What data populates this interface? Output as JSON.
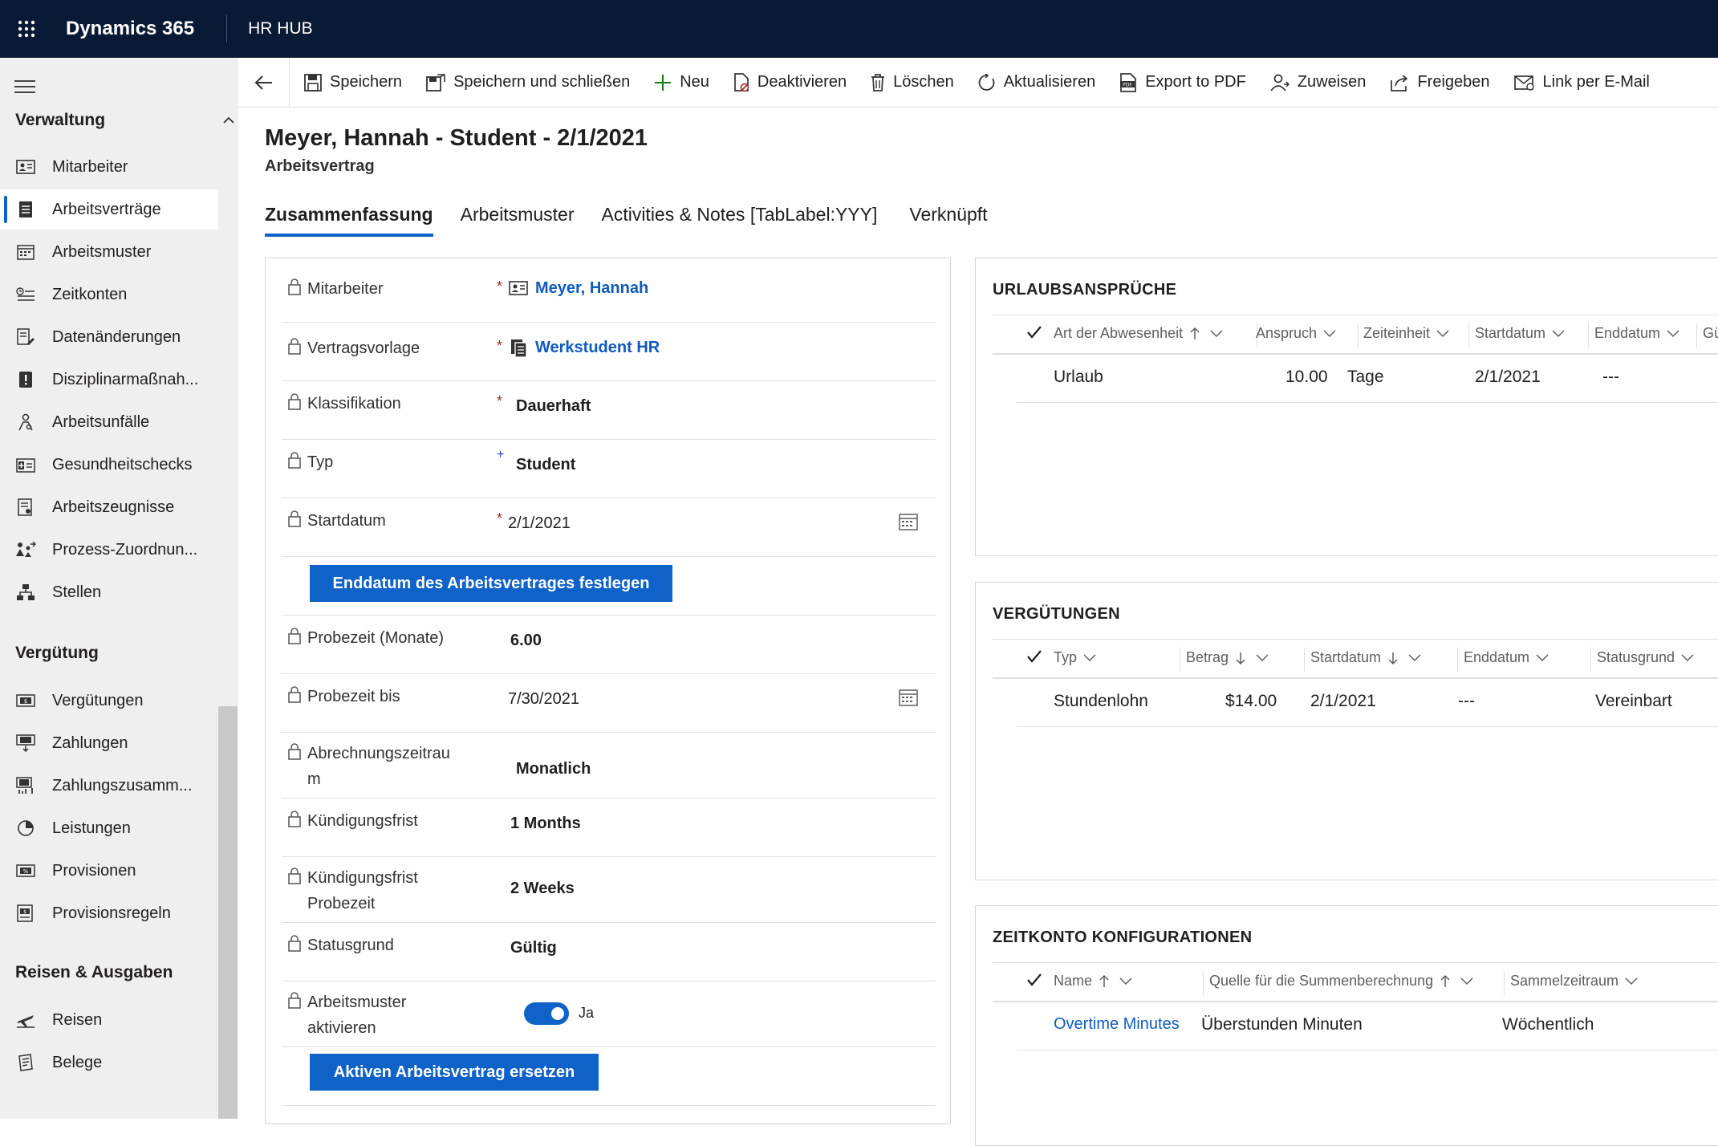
{
  "topbar": {
    "app_name": "Dynamics 365",
    "area_name": "HR HUB"
  },
  "nav": {
    "groups": [
      {
        "title": "Verwaltung"
      },
      {
        "title": "Vergütung"
      },
      {
        "title": "Reisen & Ausgaben"
      }
    ],
    "verwaltung": [
      "Mitarbeiter",
      "Arbeitsverträge",
      "Arbeitsmuster",
      "Zeitkonten",
      "Datenänderungen",
      "Disziplinarmaßnah...",
      "Arbeitsunfälle",
      "Gesundheitschecks",
      "Arbeitszeugnisse",
      "Prozess-Zuordnun...",
      "Stellen"
    ],
    "verguetung": [
      "Vergütungen",
      "Zahlungen",
      "Zahlungszusamm...",
      "Leistungen",
      "Provisionen",
      "Provisionsregeln"
    ],
    "reisen": [
      "Reisen",
      "Belege"
    ]
  },
  "commands": [
    "Speichern",
    "Speichern und schließen",
    "Neu",
    "Deaktivieren",
    "Löschen",
    "Aktualisieren",
    "Export to PDF",
    "Zuweisen",
    "Freigeben",
    "Link per E-Mail"
  ],
  "header": {
    "title": "Meyer, Hannah  - Student - 2/1/2021",
    "subtitle": "Arbeitsvertrag"
  },
  "tabs": [
    "Zusammenfassung",
    "Arbeitsmuster",
    "Activities & Notes [TabLabel:YYY]",
    "Verknüpft"
  ],
  "form": {
    "mitarbeiter_label": "Mitarbeiter",
    "mitarbeiter_value": "Meyer, Hannah",
    "vorlage_label": "Vertragsvorlage",
    "vorlage_value": "Werkstudent HR",
    "klassifikation_label": "Klassifikation",
    "klassifikation_value": "Dauerhaft",
    "typ_label": "Typ",
    "typ_value": "Student",
    "startdatum_label": "Startdatum",
    "startdatum_value": "2/1/2021",
    "enddatum_button": "Enddatum des Arbeitsvertrages festlegen",
    "probezeit_label": "Probezeit (Monate)",
    "probezeit_value": "6.00",
    "probezeit_bis_label": "Probezeit bis",
    "probezeit_bis_value": "7/30/2021",
    "abrechnung_label_1": "Abrechnungszeitrau",
    "abrechnung_label_2": "m",
    "abrechnung_value": "Monatlich",
    "kuendigung_label": "Kündigungsfrist",
    "kuendigung_value": "1 Months",
    "kuendigung_pz_label_1": "Kündigungsfrist",
    "kuendigung_pz_label_2": "Probezeit",
    "kuendigung_pz_value": "2 Weeks",
    "statusgrund_label": "Statusgrund",
    "statusgrund_value": "Gültig",
    "arbeitsmuster_label_1": "Arbeitsmuster",
    "arbeitsmuster_label_2": "aktivieren",
    "arbeitsmuster_value": "Ja",
    "ersetzen_button": "Aktiven Arbeitsvertrag ersetzen",
    "required_mark": "*",
    "recommended_mark": "+"
  },
  "urlaub": {
    "title": "URLAUBSANSPRÜCHE",
    "columns": [
      "Art der Abwesenheit",
      "Anspruch",
      "Zeiteinheit",
      "Startdatum",
      "Enddatum",
      "Gü"
    ],
    "rows": [
      {
        "art": "Urlaub",
        "anspruch": "10.00",
        "einheit": "Tage",
        "start": "2/1/2021",
        "ende": "---",
        "extra": "--"
      }
    ]
  },
  "verguetungen": {
    "title": "VERGÜTUNGEN",
    "columns": [
      "Typ",
      "Betrag",
      "Startdatum",
      "Enddatum",
      "Statusgrund"
    ],
    "rows": [
      {
        "typ": "Stundenlohn",
        "betrag": "$14.00",
        "start": "2/1/2021",
        "ende": "---",
        "status": "Vereinbart"
      }
    ]
  },
  "zeitkonto": {
    "title": "ZEITKONTO KONFIGURATIONEN",
    "columns": [
      "Name",
      "Quelle für die Summenberechnung",
      "Sammelzeitraum"
    ],
    "rows": [
      {
        "name": "Overtime Minutes",
        "quelle": "Überstunden Minuten",
        "zeitraum": "Wöchentlich"
      }
    ]
  },
  "colors": {
    "topbar": "#0b1a34",
    "accent": "#0f62c8",
    "link": "#0f5bbd",
    "required": "#a4262c"
  }
}
